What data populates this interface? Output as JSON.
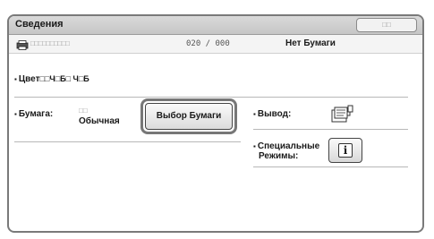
{
  "title": "Сведения",
  "titlebar_button": "□□",
  "job_row": {
    "icon": "printer-job-icon",
    "name": "□□□□□□□□□□",
    "counter": "020 / 000",
    "status": "Нет Бумаги"
  },
  "color_row": {
    "label": "Цвет",
    "value": "□□Ч□Б□ Ч□Б"
  },
  "paper": {
    "label": "Бумага:",
    "value_top": "□□",
    "value": "Обычная",
    "select_button": "Выбор Бумаги"
  },
  "output": {
    "label": "Вывод:",
    "icon": "output-tray-icon"
  },
  "special": {
    "label_line1": "Специальные",
    "label_line2": "Режимы:",
    "button_icon": "info-icon"
  }
}
